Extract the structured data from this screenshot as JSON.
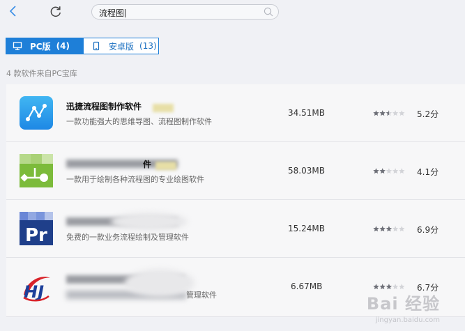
{
  "topbar": {
    "back_icon": "chevron-left-icon",
    "refresh_icon": "refresh-icon",
    "search": {
      "value": "流程图",
      "icon": "search-icon"
    }
  },
  "tabs": [
    {
      "label": "PC版",
      "count": "(4)",
      "icon": "monitor-icon",
      "active": true
    },
    {
      "label": "安卓版",
      "count": "(13)",
      "icon": "phone-icon",
      "active": false
    }
  ],
  "result_count": "4 款软件来自PC宝库",
  "apps": [
    {
      "name": "迅捷流程图制作软件",
      "desc": "一款功能强大的思维导图、流程图制作软件",
      "size": "34.51MB",
      "rating": "5.2分",
      "stars": 2.5
    },
    {
      "name_visible": "件",
      "desc": "一款用于绘制各种流程图的专业绘图软件",
      "size": "58.03MB",
      "rating": "4.1分",
      "stars": 2
    },
    {
      "desc_visible": "免费的一款业务流程绘制及管理软件",
      "size": "15.24MB",
      "rating": "6.9分",
      "stars": 3
    },
    {
      "desc_visible": "管理软件",
      "size": "6.67MB",
      "rating": "6.7分",
      "stars": 3
    }
  ],
  "watermark": {
    "text": "Bai 经验",
    "sub": "jingyan.baidu.com"
  },
  "colors": {
    "accent": "#1e7fd8",
    "tab_text": "#1a6fc0",
    "bg": "#f0f1f5"
  }
}
